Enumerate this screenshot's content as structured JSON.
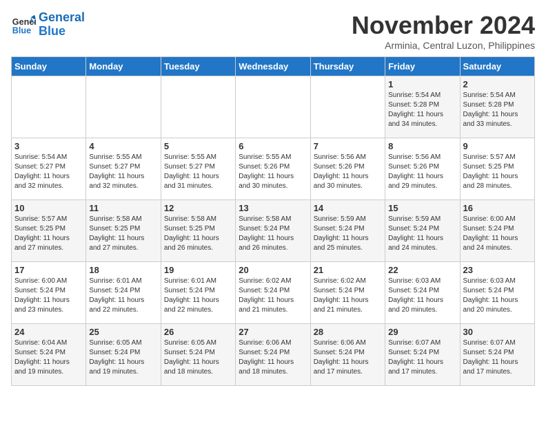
{
  "header": {
    "logo_line1": "General",
    "logo_line2": "Blue",
    "month": "November 2024",
    "location": "Arminia, Central Luzon, Philippines"
  },
  "days_of_week": [
    "Sunday",
    "Monday",
    "Tuesday",
    "Wednesday",
    "Thursday",
    "Friday",
    "Saturday"
  ],
  "weeks": [
    [
      {
        "day": "",
        "info": ""
      },
      {
        "day": "",
        "info": ""
      },
      {
        "day": "",
        "info": ""
      },
      {
        "day": "",
        "info": ""
      },
      {
        "day": "",
        "info": ""
      },
      {
        "day": "1",
        "info": "Sunrise: 5:54 AM\nSunset: 5:28 PM\nDaylight: 11 hours\nand 34 minutes."
      },
      {
        "day": "2",
        "info": "Sunrise: 5:54 AM\nSunset: 5:28 PM\nDaylight: 11 hours\nand 33 minutes."
      }
    ],
    [
      {
        "day": "3",
        "info": "Sunrise: 5:54 AM\nSunset: 5:27 PM\nDaylight: 11 hours\nand 32 minutes."
      },
      {
        "day": "4",
        "info": "Sunrise: 5:55 AM\nSunset: 5:27 PM\nDaylight: 11 hours\nand 32 minutes."
      },
      {
        "day": "5",
        "info": "Sunrise: 5:55 AM\nSunset: 5:27 PM\nDaylight: 11 hours\nand 31 minutes."
      },
      {
        "day": "6",
        "info": "Sunrise: 5:55 AM\nSunset: 5:26 PM\nDaylight: 11 hours\nand 30 minutes."
      },
      {
        "day": "7",
        "info": "Sunrise: 5:56 AM\nSunset: 5:26 PM\nDaylight: 11 hours\nand 30 minutes."
      },
      {
        "day": "8",
        "info": "Sunrise: 5:56 AM\nSunset: 5:26 PM\nDaylight: 11 hours\nand 29 minutes."
      },
      {
        "day": "9",
        "info": "Sunrise: 5:57 AM\nSunset: 5:25 PM\nDaylight: 11 hours\nand 28 minutes."
      }
    ],
    [
      {
        "day": "10",
        "info": "Sunrise: 5:57 AM\nSunset: 5:25 PM\nDaylight: 11 hours\nand 27 minutes."
      },
      {
        "day": "11",
        "info": "Sunrise: 5:58 AM\nSunset: 5:25 PM\nDaylight: 11 hours\nand 27 minutes."
      },
      {
        "day": "12",
        "info": "Sunrise: 5:58 AM\nSunset: 5:25 PM\nDaylight: 11 hours\nand 26 minutes."
      },
      {
        "day": "13",
        "info": "Sunrise: 5:58 AM\nSunset: 5:24 PM\nDaylight: 11 hours\nand 26 minutes."
      },
      {
        "day": "14",
        "info": "Sunrise: 5:59 AM\nSunset: 5:24 PM\nDaylight: 11 hours\nand 25 minutes."
      },
      {
        "day": "15",
        "info": "Sunrise: 5:59 AM\nSunset: 5:24 PM\nDaylight: 11 hours\nand 24 minutes."
      },
      {
        "day": "16",
        "info": "Sunrise: 6:00 AM\nSunset: 5:24 PM\nDaylight: 11 hours\nand 24 minutes."
      }
    ],
    [
      {
        "day": "17",
        "info": "Sunrise: 6:00 AM\nSunset: 5:24 PM\nDaylight: 11 hours\nand 23 minutes."
      },
      {
        "day": "18",
        "info": "Sunrise: 6:01 AM\nSunset: 5:24 PM\nDaylight: 11 hours\nand 22 minutes."
      },
      {
        "day": "19",
        "info": "Sunrise: 6:01 AM\nSunset: 5:24 PM\nDaylight: 11 hours\nand 22 minutes."
      },
      {
        "day": "20",
        "info": "Sunrise: 6:02 AM\nSunset: 5:24 PM\nDaylight: 11 hours\nand 21 minutes."
      },
      {
        "day": "21",
        "info": "Sunrise: 6:02 AM\nSunset: 5:24 PM\nDaylight: 11 hours\nand 21 minutes."
      },
      {
        "day": "22",
        "info": "Sunrise: 6:03 AM\nSunset: 5:24 PM\nDaylight: 11 hours\nand 20 minutes."
      },
      {
        "day": "23",
        "info": "Sunrise: 6:03 AM\nSunset: 5:24 PM\nDaylight: 11 hours\nand 20 minutes."
      }
    ],
    [
      {
        "day": "24",
        "info": "Sunrise: 6:04 AM\nSunset: 5:24 PM\nDaylight: 11 hours\nand 19 minutes."
      },
      {
        "day": "25",
        "info": "Sunrise: 6:05 AM\nSunset: 5:24 PM\nDaylight: 11 hours\nand 19 minutes."
      },
      {
        "day": "26",
        "info": "Sunrise: 6:05 AM\nSunset: 5:24 PM\nDaylight: 11 hours\nand 18 minutes."
      },
      {
        "day": "27",
        "info": "Sunrise: 6:06 AM\nSunset: 5:24 PM\nDaylight: 11 hours\nand 18 minutes."
      },
      {
        "day": "28",
        "info": "Sunrise: 6:06 AM\nSunset: 5:24 PM\nDaylight: 11 hours\nand 17 minutes."
      },
      {
        "day": "29",
        "info": "Sunrise: 6:07 AM\nSunset: 5:24 PM\nDaylight: 11 hours\nand 17 minutes."
      },
      {
        "day": "30",
        "info": "Sunrise: 6:07 AM\nSunset: 5:24 PM\nDaylight: 11 hours\nand 17 minutes."
      }
    ]
  ]
}
